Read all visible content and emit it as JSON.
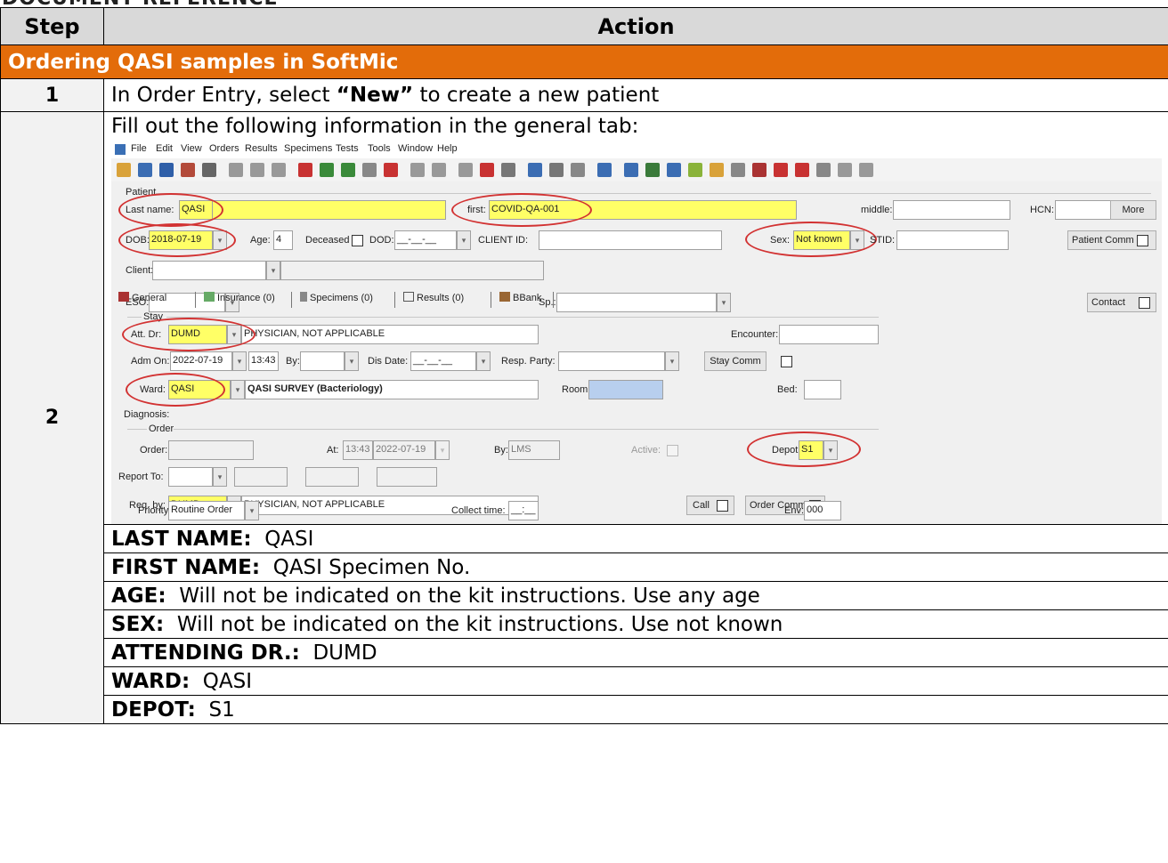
{
  "top_fragment": "DOCUMENT REFERENCE",
  "table": {
    "col_step": "Step",
    "col_action": "Action",
    "section_title": "Ordering QASI samples in SoftMic",
    "steps": [
      {
        "num": "1",
        "pre": "In Order Entry, select ",
        "bold": "“New”",
        "post": " to create a new patient"
      },
      {
        "num": "2",
        "intro": "Fill out the following information in the general tab:"
      }
    ],
    "info": [
      {
        "label": "LAST NAME:",
        "value": "QASI"
      },
      {
        "label": "FIRST NAME:",
        "value": "QASI Specimen No."
      },
      {
        "label": "AGE:",
        "value": "Will not be indicated on the kit instructions.  Use any age"
      },
      {
        "label": "SEX:",
        "value": "Will not be indicated on the kit instructions.  Use not known"
      },
      {
        "label": "ATTENDING DR.:",
        "value": "DUMD"
      },
      {
        "label": "WARD:",
        "value": "QASI"
      },
      {
        "label": "DEPOT:",
        "value": "S1"
      }
    ]
  },
  "shot": {
    "menu": [
      "File",
      "Edit",
      "View",
      "Orders",
      "Results",
      "Specimens",
      "Tests",
      "Tools",
      "Window",
      "Help"
    ],
    "patient_group": "Patient",
    "last_name_label": "Last name:",
    "last_name": "QASI",
    "first_label": "first:",
    "first": "COVID-QA-001",
    "middle_label": "middle:",
    "hcn_label": "HCN:",
    "more": "More",
    "dob_label": "DOB:",
    "dob": "2018-07-19",
    "age_label": "Age:",
    "age": "4",
    "deceased_label": "Deceased",
    "dod_label": "DOD:",
    "dod": "__-__-__",
    "client_id_label": "CLIENT ID:",
    "sex_label": "Sex:",
    "sex": "Not known",
    "stid_label": "STID:",
    "patient_comm": "Patient Comm",
    "client_label": "Client:",
    "eso_label": "ESO:",
    "sp_label": "Sp.:",
    "contact": "Contact",
    "tabs": [
      "General",
      "Insurance (0)",
      "Specimens (0)",
      "Results (0)",
      "BBank"
    ],
    "stay_group": "Stay",
    "att_dr_label": "Att. Dr:",
    "att_dr": "DUMD",
    "att_dr_name": "PHYSICIAN, NOT APPLICABLE",
    "encounter_label": "Encounter:",
    "adm_on_label": "Adm On:",
    "adm_date": "2022-07-19",
    "adm_time": "13:43",
    "by_label": "By:",
    "dis_date_label": "Dis Date:",
    "dis_date": "__-__-__",
    "resp_party_label": "Resp. Party:",
    "stay_comm": "Stay Comm",
    "ward_label": "Ward:",
    "ward": "QASI",
    "ward_name": "QASI SURVEY (Bacteriology)",
    "room_label": "Room:",
    "bed_label": "Bed:",
    "diagnosis_label": "Diagnosis:",
    "order_group": "Order",
    "order_label": "Order:",
    "at_label": "At:",
    "at_time": "13:43",
    "at_date": "2022-07-19",
    "order_by_label": "By:",
    "order_by": "LMS",
    "active_label": "Active:",
    "depot_label": "Depot:",
    "depot": "S1",
    "report_to_label": "Report To:",
    "req_by_label": "Req. by:",
    "req_by": "DUMD",
    "req_by_name": "PHYSICIAN, NOT APPLICABLE",
    "call": "Call",
    "order_comm": "Order Comm.",
    "priority_label": "Priority:",
    "priority": "Routine Order",
    "collect_label": "Collect time:",
    "collect": "__:__",
    "env_label": "Env:",
    "env": "000"
  }
}
